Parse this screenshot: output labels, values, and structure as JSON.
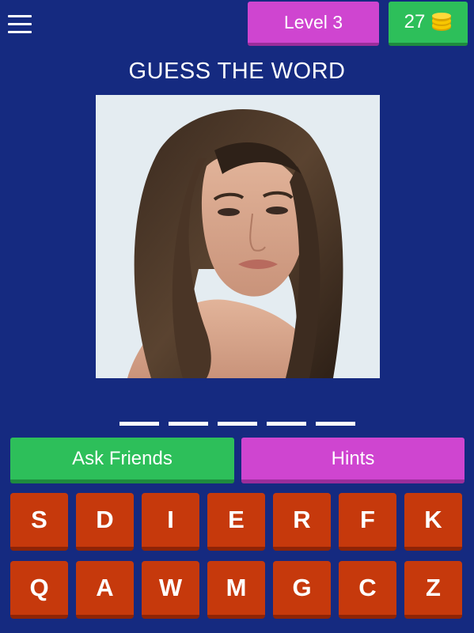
{
  "header": {
    "level_label": "Level 3",
    "coins": "27",
    "icons": {
      "menu": "hamburger-menu-icon",
      "coins": "coin-stack-icon"
    }
  },
  "title": "GUESS THE WORD",
  "photo": {
    "description_icon": "portrait-photo"
  },
  "answer": {
    "slot_count": 5
  },
  "buttons": {
    "ask_friends": "Ask Friends",
    "hints": "Hints"
  },
  "letters": [
    "S",
    "D",
    "I",
    "E",
    "R",
    "F",
    "K",
    "Q",
    "A",
    "W",
    "M",
    "G",
    "C",
    "Z"
  ],
  "colors": {
    "background": "#152a80",
    "level": "#cf45d0",
    "coins": "#2dbf5a",
    "key": "#c6390c"
  }
}
